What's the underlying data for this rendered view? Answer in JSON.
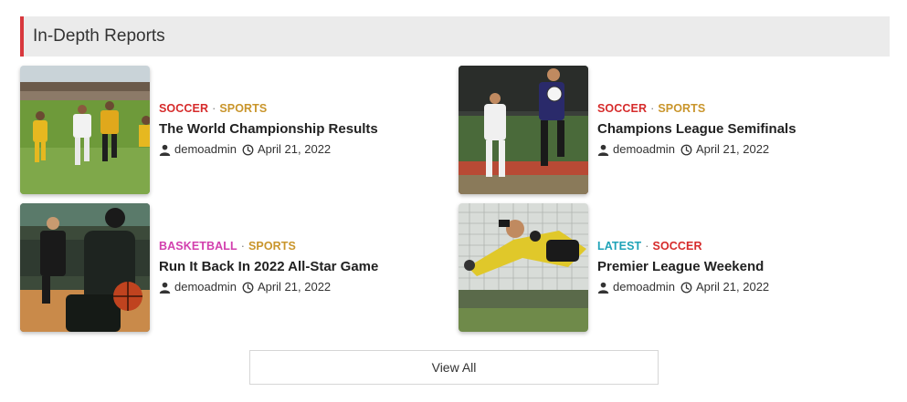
{
  "section": {
    "title": "In-Depth Reports",
    "accent_color": "#d8383d"
  },
  "category_colors": {
    "SOCCER": "#d62b2b",
    "SPORTS": "#c9952b",
    "BASKETBALL": "#d23fae",
    "LATEST": "#1fa3b8"
  },
  "posts": [
    {
      "cat1": "SOCCER",
      "cat1_color": "#d62b2b",
      "cat2": "SPORTS",
      "cat2_color": "#c9952b",
      "title": "The World Championship Results",
      "author": "demoadmin",
      "date": "April 21, 2022",
      "image": "soccer-players-match-photo"
    },
    {
      "cat1": "SOCCER",
      "cat1_color": "#d62b2b",
      "cat2": "SPORTS",
      "cat2_color": "#c9952b",
      "title": "Champions League Semifinals",
      "author": "demoadmin",
      "date": "April 21, 2022",
      "image": "soccer-header-duel-photo"
    },
    {
      "cat1": "BASKETBALL",
      "cat1_color": "#d23fae",
      "cat2": "SPORTS",
      "cat2_color": "#c9952b",
      "title": "Run It Back In 2022 All-Star Game",
      "author": "demoadmin",
      "date": "April 21, 2022",
      "image": "basketball-player-dribble-photo"
    },
    {
      "cat1": "LATEST",
      "cat1_color": "#1fa3b8",
      "cat2": "SOCCER",
      "cat2_color": "#d62b2b",
      "title": "Premier League Weekend",
      "author": "demoadmin",
      "date": "April 21, 2022",
      "image": "goalkeeper-diving-save-photo"
    }
  ],
  "separator": "·",
  "view_all_label": "View All"
}
